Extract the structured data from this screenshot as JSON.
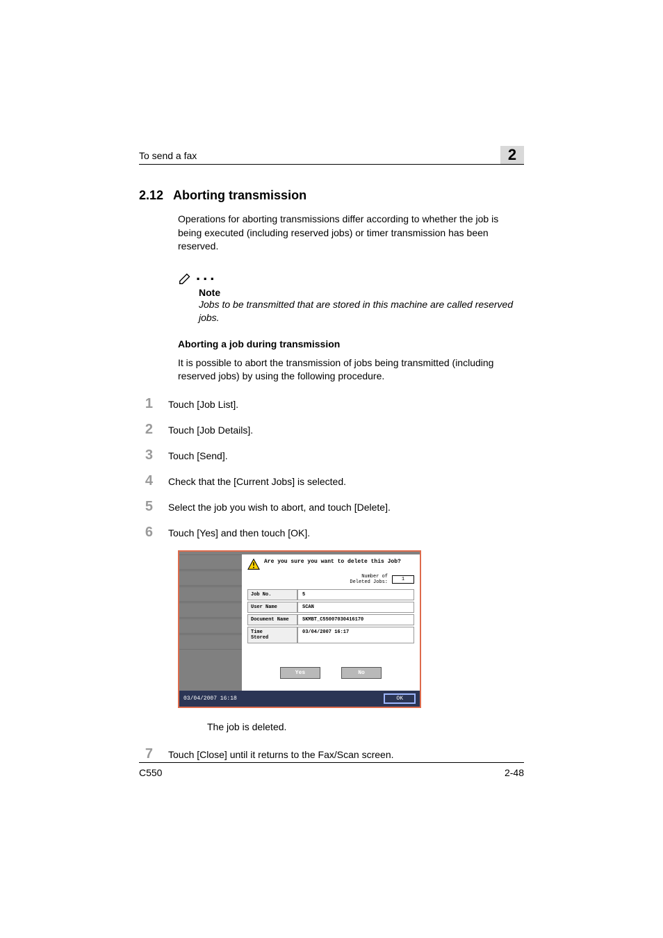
{
  "header": {
    "running_title": "To send a fax",
    "chapter_num": "2"
  },
  "section": {
    "number": "2.12",
    "title": "Aborting transmission",
    "intro": "Operations for aborting transmissions differ according to whether the job is being executed (including reserved jobs) or timer transmission has been reserved."
  },
  "note": {
    "label": "Note",
    "text": "Jobs to be transmitted that are stored in this machine are called reserved jobs."
  },
  "sub": {
    "heading": "Aborting a job during transmission",
    "intro": "It is possible to abort the transmission of jobs being transmitted (including reserved jobs) by using the following procedure."
  },
  "steps": [
    "Touch [Job List].",
    "Touch [Job Details].",
    "Touch [Send].",
    "Check that the [Current Jobs] is selected.",
    "Select the job you wish to abort, and touch [Delete].",
    "Touch [Yes] and then touch [OK]."
  ],
  "after_dialog_text": "The job is deleted.",
  "step7": "Touch [Close] until it returns to the Fax/Scan screen.",
  "dialog": {
    "question": "Are you sure you want to delete this Job?",
    "count_label": "Number of\nDeleted Jobs:",
    "count_value": "1",
    "rows": {
      "jobno_label": "Job No.",
      "jobno_value": "5",
      "user_label": "User Name",
      "user_value": "SCAN",
      "doc_label": "Document Name",
      "doc_value": "SKMBT_C55007030416170",
      "time_label": "Time\nStored",
      "time_value": "03/04/2007  16:17"
    },
    "yes": "Yes",
    "no": "No",
    "footer_time": "03/04/2007   16:18",
    "ok": "OK"
  },
  "footer": {
    "model": "C550",
    "page": "2-48"
  }
}
